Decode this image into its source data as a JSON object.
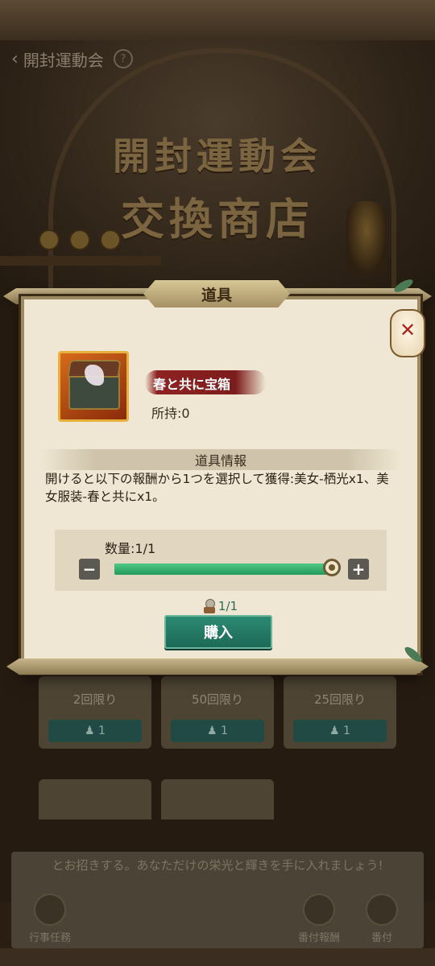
{
  "header": {
    "back_title": "開封運動会"
  },
  "background": {
    "shop_title_line1": "開封運動会",
    "shop_title_line2": "交換商店",
    "cards": [
      {
        "limit": "2回限り",
        "price": "1"
      },
      {
        "limit": "50回限り",
        "price": "1"
      },
      {
        "limit": "25回限り",
        "price": "1"
      }
    ],
    "scroll_text": "とお招きする。あなただけの栄光と輝きを手に入れましょう!",
    "tabs": [
      {
        "label": "行事任務"
      },
      {
        "label": "番付報酬"
      },
      {
        "label": "番付"
      }
    ]
  },
  "modal": {
    "title": "道具",
    "item_name": "春と共に宝箱",
    "owned": "所持:0",
    "section_title": "道具情報",
    "description": "開けると以下の報酬から1つを選択して獲得:美女-栖光x1、美女服装-春と共にx1。",
    "quantity_label": "数量:1/1",
    "quantity_fraction": 1.0,
    "price_text": "1/1",
    "buy_label": "購入",
    "minus_label": "−",
    "plus_label": "+"
  },
  "colors": {
    "accent_green": "#239a5c",
    "button_teal": "#1d6a57",
    "name_red": "#8e2323"
  },
  "icons": {
    "back": "chevron-left-icon",
    "help": "question-circle-icon",
    "item": "treasure-chest-icon",
    "currency": "coin-icon",
    "lantern": "lantern-icon"
  }
}
